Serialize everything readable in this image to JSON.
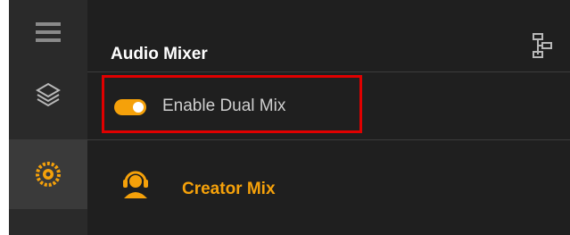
{
  "sidebar": {
    "items": [
      {
        "icon": "hamburger-menu-icon"
      },
      {
        "icon": "layers-icon"
      },
      {
        "icon": "audio-mixer-icon",
        "active": true
      }
    ]
  },
  "header": {
    "title": "Audio Mixer",
    "action_icon": "routing-diagram-icon"
  },
  "dual_mix": {
    "label": "Enable Dual Mix",
    "enabled": true
  },
  "creator_mix": {
    "label": "Creator Mix",
    "icon": "headset-user-icon"
  },
  "colors": {
    "accent": "#f5a10a",
    "highlight_border": "#e00000",
    "background": "#1f1f1f",
    "rail": "#2a2a2a"
  }
}
